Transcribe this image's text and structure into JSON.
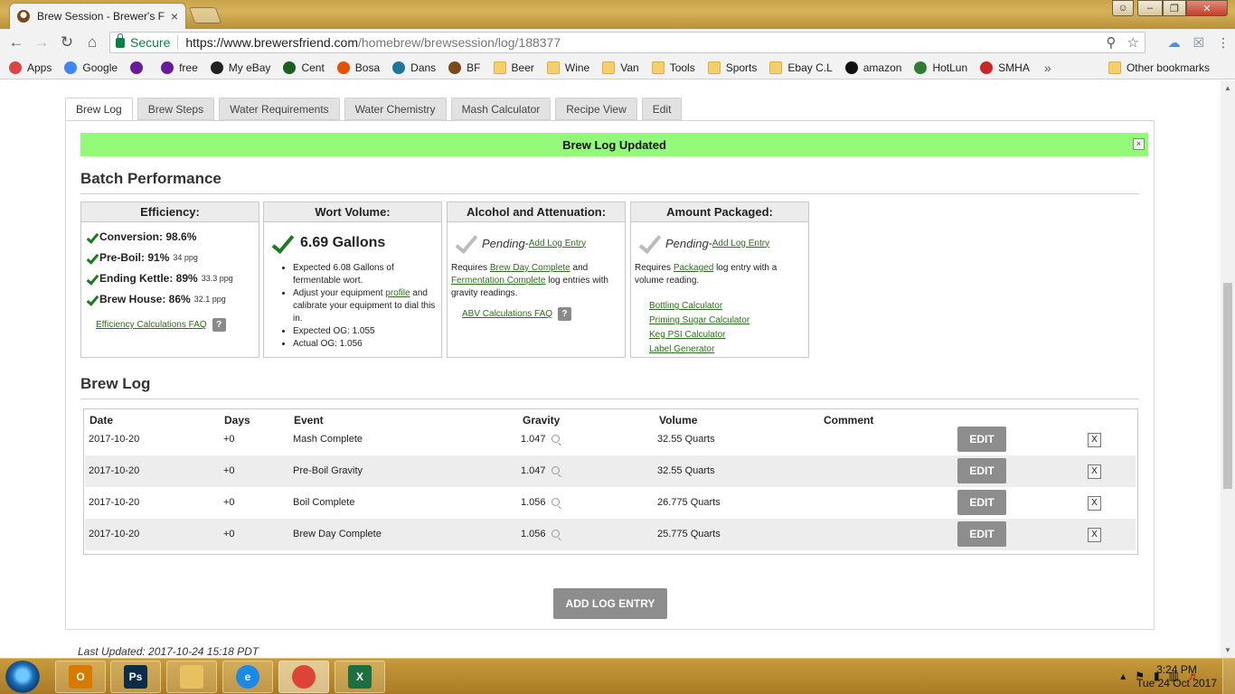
{
  "browser": {
    "tab_title": "Brew Session - Brewer's F",
    "tab_close": "×",
    "url_secure_label": "Secure",
    "url_host": "https://www.brewersfriend.com",
    "url_path": "/homebrew/brewsession/log/188377",
    "bookmarks": [
      {
        "label": "Apps",
        "icon": "apps-grid-icon",
        "color": "#d44"
      },
      {
        "label": "Google",
        "icon": "google-icon",
        "color": "#4285f4"
      },
      {
        "label": "",
        "icon": "peace-icon",
        "color": "#6a1b9a"
      },
      {
        "label": "free",
        "icon": "peace-icon",
        "color": "#6a1b9a"
      },
      {
        "label": "My eBay",
        "icon": "shop-icon",
        "color": "#222"
      },
      {
        "label": "Cent",
        "icon": "cent-icon",
        "color": "#1b5e20"
      },
      {
        "label": "Bosa",
        "icon": "bosa-icon",
        "color": "#e65100"
      },
      {
        "label": "Dans",
        "icon": "wordpress-icon",
        "color": "#21759b"
      },
      {
        "label": "BF",
        "icon": "brewersfriend-icon",
        "color": "#7a4a1c"
      },
      {
        "label": "Beer",
        "icon": "folder-icon"
      },
      {
        "label": "Wine",
        "icon": "folder-icon"
      },
      {
        "label": "Van",
        "icon": "folder-icon"
      },
      {
        "label": "Tools",
        "icon": "folder-icon"
      },
      {
        "label": "Sports",
        "icon": "folder-icon"
      },
      {
        "label": "Ebay C.L",
        "icon": "folder-icon"
      },
      {
        "label": "amazon",
        "icon": "amazon-icon",
        "color": "#111"
      },
      {
        "label": "HotLun",
        "icon": "hl-icon",
        "color": "#2e7d32"
      },
      {
        "label": "SMHA",
        "icon": "gl-icon",
        "color": "#c62828"
      }
    ],
    "bookmarks_more": "»",
    "other_bookmarks": "Other bookmarks"
  },
  "tabs": [
    "Brew Log",
    "Brew Steps",
    "Water Requirements",
    "Water Chemistry",
    "Mash Calculator",
    "Recipe View",
    "Edit"
  ],
  "alert": {
    "message": "Brew Log Updated",
    "close": "×"
  },
  "batch_performance": {
    "title": "Batch Performance",
    "efficiency": {
      "head": "Efficiency:",
      "rows": [
        {
          "label": "Conversion: 98.6%",
          "sub": ""
        },
        {
          "label": "Pre-Boil: 91%",
          "sub": "34 ppg"
        },
        {
          "label": "Ending Kettle: 89%",
          "sub": "33.3 ppg"
        },
        {
          "label": "Brew House: 86%",
          "sub": "32.1 ppg"
        }
      ],
      "faq": "Efficiency Calculations FAQ",
      "help": "?"
    },
    "wort": {
      "head": "Wort Volume:",
      "value": "6.69 Gallons",
      "bullet1": "Expected 6.08 Gallons of fermentable wort.",
      "bullet2_pre": "Adjust your equipment ",
      "bullet2_link": "profile",
      "bullet2_post": " and calibrate your equipment to dial this in.",
      "bullet3": "Expected OG: 1.055",
      "bullet4": "Actual OG: 1.056"
    },
    "alcohol": {
      "head": "Alcohol and Attenuation:",
      "pending": "Pending",
      "dash": " - ",
      "add_link": "Add Log Entry",
      "req_pre": "Requires ",
      "req_link1": "Brew Day Complete",
      "req_mid": " and ",
      "req_link2": "Fermentation Complete",
      "req_post": " log entries with gravity readings.",
      "faq": "ABV Calculations FAQ",
      "help": "?"
    },
    "packaged": {
      "head": "Amount Packaged:",
      "pending": "Pending",
      "dash": " - ",
      "add_link": "Add Log Entry",
      "req_pre": "Requires ",
      "req_link": "Packaged",
      "req_post": " log entry with a volume reading.",
      "links": [
        "Bottling Calculator",
        "Priming Sugar Calculator",
        "Keg PSI Calculator",
        "Label Generator"
      ]
    }
  },
  "brew_log": {
    "title": "Brew Log",
    "columns": [
      "Date",
      "Days",
      "Event",
      "Gravity",
      "Volume",
      "Comment"
    ],
    "rows": [
      {
        "date": "2017-10-20",
        "days": "+0",
        "event": "Mash Complete",
        "gravity": "1.047",
        "volume": "32.55 Quarts",
        "comment": ""
      },
      {
        "date": "2017-10-20",
        "days": "+0",
        "event": "Pre-Boil Gravity",
        "gravity": "1.047",
        "volume": "32.55 Quarts",
        "comment": ""
      },
      {
        "date": "2017-10-20",
        "days": "+0",
        "event": "Boil Complete",
        "gravity": "1.056",
        "volume": "26.775 Quarts",
        "comment": ""
      },
      {
        "date": "2017-10-20",
        "days": "+0",
        "event": "Brew Day Complete",
        "gravity": "1.056",
        "volume": "25.775 Quarts",
        "comment": ""
      }
    ],
    "edit_label": "EDIT",
    "delete_label": "X",
    "add_button": "ADD LOG ENTRY"
  },
  "last_updated": "Last Updated: 2017-10-24 15:18 PDT",
  "taskbar": {
    "apps": [
      {
        "name": "outlook",
        "glyph": "O",
        "color": "#d97a00"
      },
      {
        "name": "photoshop",
        "glyph": "Ps",
        "color": "#0b2d4a"
      },
      {
        "name": "explorer",
        "glyph": "",
        "color": "#e8c060"
      },
      {
        "name": "internet-explorer",
        "glyph": "e",
        "color": "#1e88e5"
      },
      {
        "name": "chrome",
        "glyph": "",
        "color": "#db4437"
      },
      {
        "name": "excel",
        "glyph": "X",
        "color": "#1d6f42"
      }
    ],
    "time": "3:24 PM",
    "date": "Tue 24 Oct 2017"
  }
}
